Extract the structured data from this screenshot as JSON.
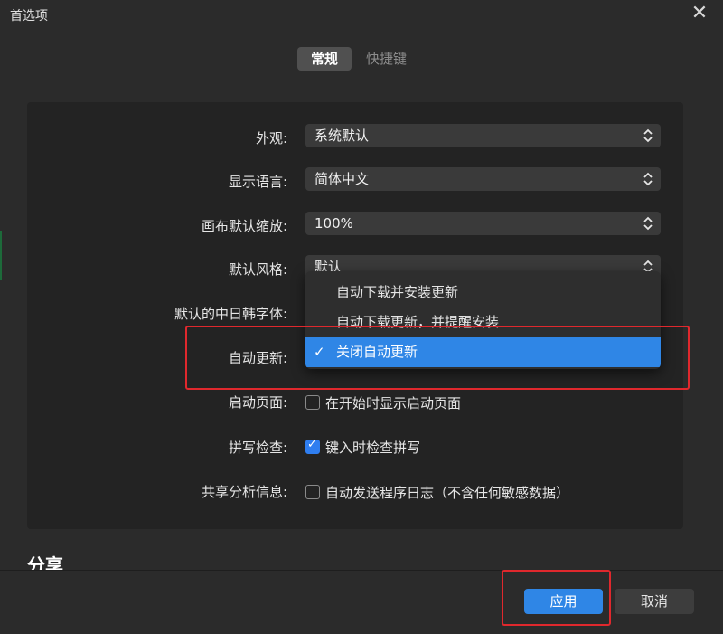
{
  "window": {
    "title": "首选项",
    "close_glyph": "✕"
  },
  "tabs": [
    {
      "label": "常规",
      "active": true
    },
    {
      "label": "快捷键",
      "active": false
    }
  ],
  "settings": {
    "appearance": {
      "label": "外观:",
      "value": "系统默认"
    },
    "language": {
      "label": "显示语言:",
      "value": "简体中文"
    },
    "canvas_zoom": {
      "label": "画布默认缩放:",
      "value": "100%"
    },
    "style": {
      "label": "默认风格:",
      "value": "默认"
    },
    "cjk_font": {
      "label": "默认的中日韩字体:"
    },
    "auto_update": {
      "label": "自动更新:"
    },
    "startup_page": {
      "label": "启动页面:",
      "checkbox_label": "在开始时显示启动页面",
      "checked": false
    },
    "spell_check": {
      "label": "拼写检查:",
      "checkbox_label": "键入时检查拼写",
      "checked": true
    },
    "share_analytics": {
      "label": "共享分析信息:",
      "checkbox_label": "自动发送程序日志（不含任何敏感数据）",
      "checked": false
    }
  },
  "update_dropdown": {
    "options": [
      {
        "label": "自动下载并安装更新",
        "selected": false
      },
      {
        "label": "自动下载更新，并提醒安装",
        "selected": false
      },
      {
        "label": "关闭自动更新",
        "selected": true
      }
    ],
    "tick_glyph": "✓"
  },
  "section": {
    "title": "分享"
  },
  "footer": {
    "apply_label": "应用",
    "cancel_label": "取消"
  },
  "colors": {
    "accent": "#2f86e6",
    "highlight_box": "#e0282d",
    "background": "#2b2b2b",
    "panel": "#232323"
  },
  "icons": {
    "select_arrows": "chevron-up-down-icon",
    "checkmark": "checkmark-icon",
    "close": "close-icon"
  }
}
